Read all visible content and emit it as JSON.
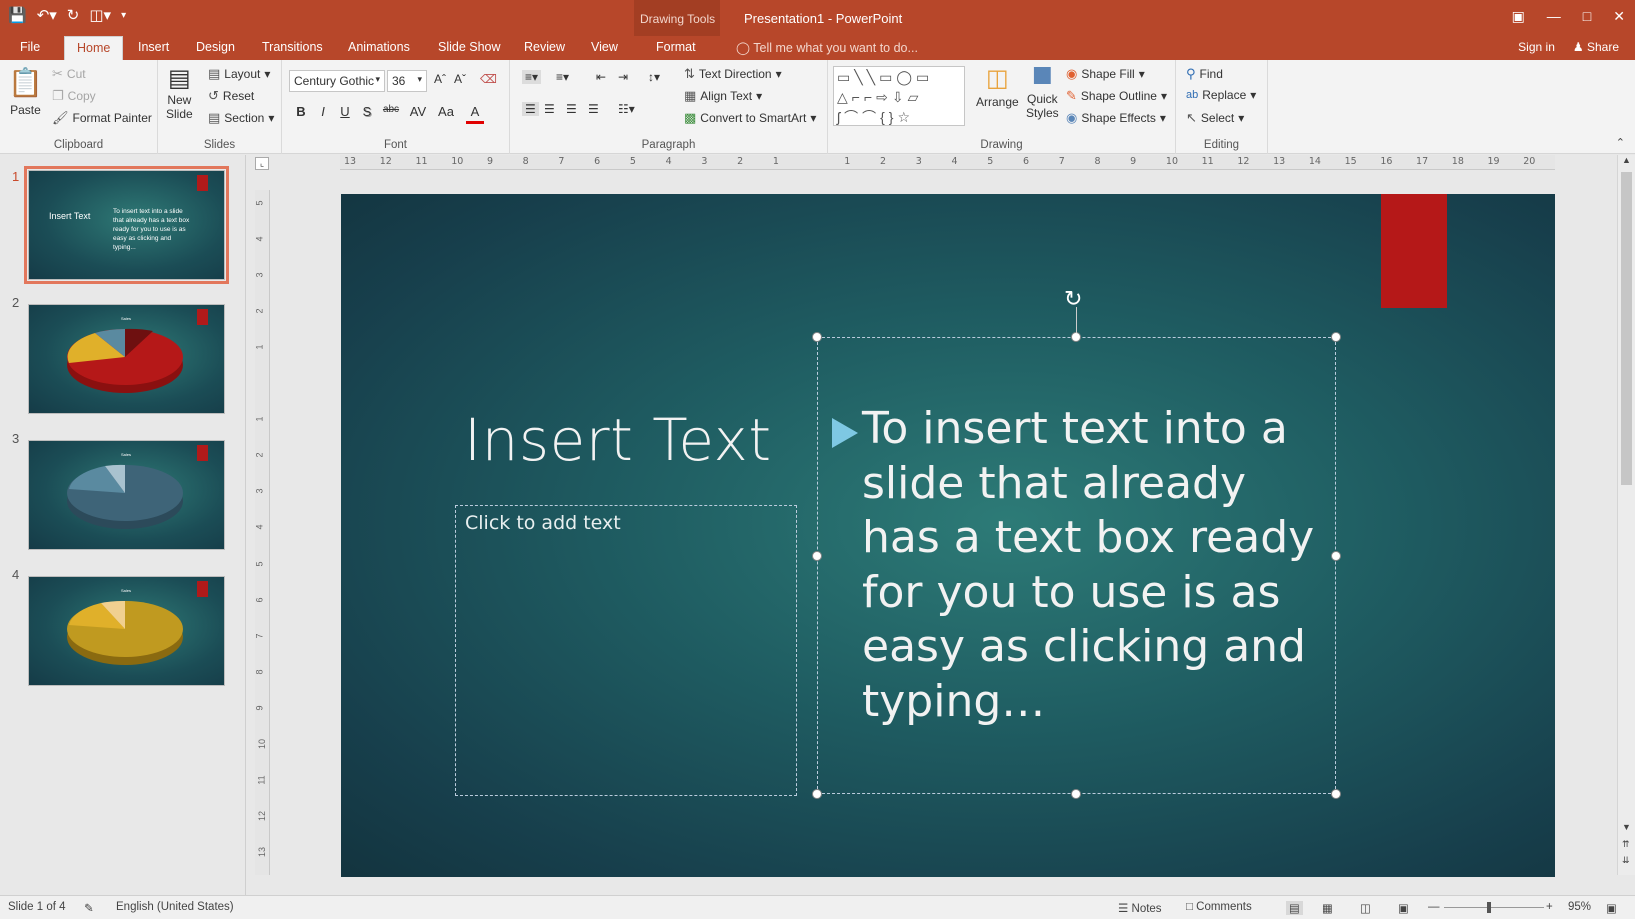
{
  "titlebar": {
    "title": "Presentation1 - PowerPoint",
    "context_label": "Drawing Tools",
    "qat_icons": [
      "save-icon",
      "undo-icon",
      "redo-icon",
      "present-icon",
      "customize-icon"
    ],
    "window_icons": [
      "restore-ribbon-icon",
      "minimize-icon",
      "maximize-icon",
      "close-icon"
    ]
  },
  "tabs": {
    "file": "File",
    "home": "Home",
    "insert": "Insert",
    "design": "Design",
    "transitions": "Transitions",
    "animations": "Animations",
    "slideshow": "Slide Show",
    "review": "Review",
    "view": "View",
    "format": "Format",
    "tellme": "Tell me what you want to do...",
    "signin": "Sign in",
    "share": "Share"
  },
  "ribbon": {
    "clipboard": {
      "label": "Clipboard",
      "paste": "Paste",
      "cut": "Cut",
      "copy": "Copy",
      "format_painter": "Format Painter"
    },
    "slides": {
      "label": "Slides",
      "new_slide_1": "New",
      "new_slide_2": "Slide",
      "layout": "Layout",
      "reset": "Reset",
      "section": "Section"
    },
    "font": {
      "label": "Font",
      "name": "Century Gothic",
      "size": "36",
      "bold": "B",
      "italic": "I",
      "underline": "U",
      "shadow": "S",
      "strike": "abc",
      "spacing": "AV",
      "case": "Aa",
      "color": "A"
    },
    "paragraph": {
      "label": "Paragraph",
      "text_direction": "Text Direction",
      "align_text": "Align Text",
      "smartart": "Convert to SmartArt"
    },
    "drawing": {
      "label": "Drawing",
      "arrange": "Arrange",
      "quick_styles_1": "Quick",
      "quick_styles_2": "Styles",
      "shape_fill": "Shape Fill",
      "shape_outline": "Shape Outline",
      "shape_effects": "Shape Effects"
    },
    "editing": {
      "label": "Editing",
      "find": "Find",
      "replace": "Replace",
      "select": "Select"
    }
  },
  "thumbnails": [
    {
      "num": "1",
      "title": "Insert Text",
      "body": "To insert text into a slide that already has a text box ready for you to use is as easy as clicking and typing..."
    },
    {
      "num": "2",
      "label": "Sales"
    },
    {
      "num": "3",
      "label": "Sales"
    },
    {
      "num": "4",
      "label": "Sales"
    }
  ],
  "ruler": {
    "h_ticks": [
      "13",
      "12",
      "11",
      "10",
      "9",
      "8",
      "7",
      "6",
      "5",
      "4",
      "3",
      "2",
      "1",
      "",
      "1",
      "2",
      "3",
      "4",
      "5",
      "6",
      "7",
      "8",
      "9",
      "10",
      "11",
      "12",
      "13",
      "14",
      "15",
      "16",
      "17",
      "18",
      "19",
      "20"
    ],
    "v_ticks": [
      "5",
      "4",
      "3",
      "2",
      "1",
      "",
      "1",
      "2",
      "3",
      "4",
      "5",
      "6",
      "7",
      "8",
      "9",
      "10",
      "11",
      "12",
      "13"
    ]
  },
  "slide": {
    "title": "Insert Text",
    "left_placeholder": "Click to add text",
    "body_lines": [
      "To insert text into a",
      "slide that already",
      "has a text box ready",
      "for you to use is as",
      "easy as clicking and",
      "typing…"
    ],
    "accent_color": "#b51818",
    "bullet_color": "#7ec8e3"
  },
  "status": {
    "slide_of": "Slide 1 of 4",
    "language": "English (United States)",
    "notes": "Notes",
    "comments": "Comments",
    "zoom": "95%"
  }
}
